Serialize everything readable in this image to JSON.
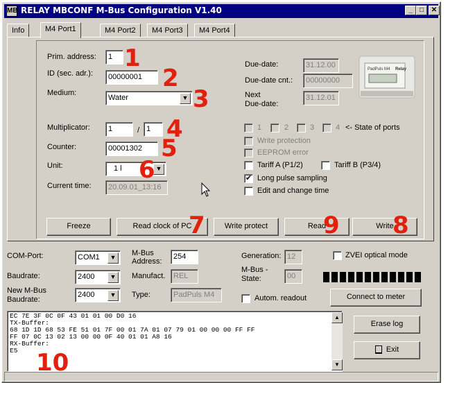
{
  "window": {
    "title": "RELAY MBCONF M-Bus Configuration  V1.40",
    "icon": "MB"
  },
  "tabs": [
    {
      "label": "Info"
    },
    {
      "label": "M4 Port1"
    },
    {
      "label": "M4 Port2"
    },
    {
      "label": "M4 Port3"
    },
    {
      "label": "M4 Port4"
    }
  ],
  "port": {
    "prim_address_label": "Prim. address:",
    "prim_address": "1",
    "id_label": "ID (sec. adr.):",
    "id": "00000001",
    "medium_label": "Medium:",
    "medium": "Water",
    "multiplicator_label": "Multiplicator:",
    "mult_a": "1",
    "mult_sep": "/",
    "mult_b": "1",
    "counter_label": "Counter:",
    "counter": "00001302",
    "unit_label": "Unit:",
    "unit": "1 l",
    "current_time_label": "Current time:",
    "current_time": "20.09.01_13:16",
    "due_date_label": "Due-date:",
    "due_date": "31.12.00",
    "due_date_cnt_label": "Due-date cnt.:",
    "due_date_cnt": "00000000",
    "next_due_label_1": "Next",
    "next_due_label_2": "Due-date:",
    "next_due": "31.12.01",
    "ports": [
      "1",
      "2",
      "3",
      "4"
    ],
    "ports_state_label": "<- State of ports",
    "write_protection": "Write protection",
    "eeprom_error": "EEPROM error",
    "tariff_a": "Tariff A (P1/2)",
    "tariff_b": "Tariff B (P3/4)",
    "long_pulse": "Long pulse sampling",
    "long_pulse_checked": "✔",
    "edit_time": "Edit and change time",
    "freeze": "Freeze",
    "read_clock": "Read clock of PC",
    "write_protect": "Write protect",
    "read": "Read",
    "write": "Write"
  },
  "conn": {
    "com_port_label": "COM-Port:",
    "com_port": "COM1",
    "baudrate_label": "Baudrate:",
    "baudrate": "2400",
    "new_baud_label_1": "New M-Bus",
    "new_baud_label_2": "Baudrate:",
    "new_baudrate": "2400",
    "mbus_addr_label_1": "M-Bus",
    "mbus_addr_label_2": "Address:",
    "mbus_addr": "254",
    "manufact_label": "Manufact.",
    "manufact": "REL",
    "type_label": "Type:",
    "type": "PadPuls M4",
    "generation_label": "Generation:",
    "generation": "12",
    "state_label_1": "M-Bus -",
    "state_label_2": "State:",
    "state": "00",
    "zvei": "ZVEI optical mode",
    "autom": "Autom. readout",
    "connect": "Connect to meter",
    "erase": "Erase log",
    "exit": "Exit"
  },
  "log": [
    "EC 7E 3F 0C 0F 43 01 01 00 D0 16",
    "TX-Buffer:",
    "68 1D 1D 68 53 FE 51 01 7F 00 01 7A 01 07 79 01 00 00 00 FF FF",
    "FF 07 0C 13 02 13 00 00 0F 40 01 01 A8 16",
    "RX-Buffer:",
    "E5"
  ],
  "callouts": [
    "1",
    "2",
    "3",
    "4",
    "5",
    "6",
    "7",
    "8",
    "9",
    "10"
  ],
  "colors": {
    "callout": "#e1200e",
    "title_bar": "#000080",
    "face": "#d4d0c8"
  },
  "device_image": {
    "brand": "Relay",
    "model": "PadPuls M4"
  }
}
